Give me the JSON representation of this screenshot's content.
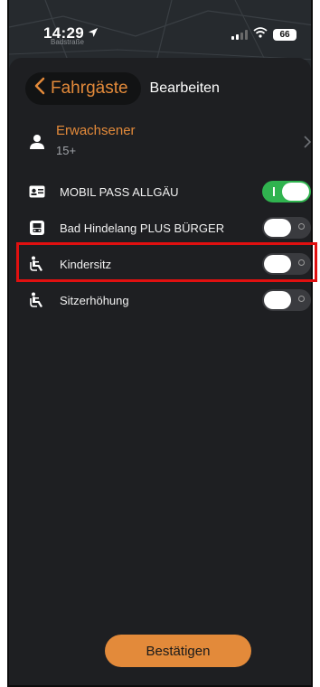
{
  "status_bar": {
    "time": "14:29",
    "map_label": "Badstraße",
    "battery": "66"
  },
  "nav": {
    "back_label": "Fahrgäste",
    "edit_label": "Bearbeiten"
  },
  "passenger": {
    "title": "Erwachsener",
    "subtitle": "15+"
  },
  "options": [
    {
      "label": "MOBIL PASS ALLGÄU",
      "icon": "id-card-icon",
      "on": true
    },
    {
      "label": "Bad Hindelang PLUS BÜRGER",
      "icon": "bus-icon",
      "on": false
    },
    {
      "label": "Kindersitz",
      "icon": "child-seat-icon",
      "on": false
    },
    {
      "label": "Sitzerhöhung",
      "icon": "child-seat-icon",
      "on": false
    }
  ],
  "confirm_label": "Bestätigen",
  "colors": {
    "accent": "#e38a3a",
    "toggle_on": "#30b34f",
    "highlight": "#e01010",
    "background": "#1e1f22"
  }
}
